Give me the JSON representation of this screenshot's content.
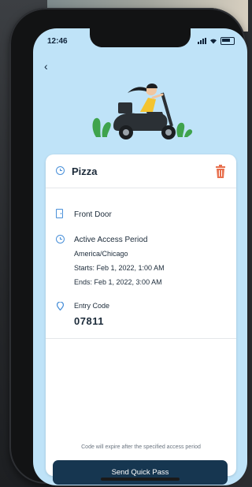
{
  "status_bar": {
    "time": "12:46"
  },
  "colors": {
    "screen_background": "#bfe3f8",
    "primary_button": "#163650",
    "icon_accent": "#4a90d9",
    "delete_icon": "#e8704e",
    "plant_green": "#3fa34d"
  },
  "pass": {
    "title": "Pizza",
    "lock_name": "Front Door",
    "access": {
      "heading": "Active Access Period",
      "timezone": "America/Chicago",
      "starts": "Starts: Feb 1, 2022, 1:00 AM",
      "ends": "Ends: Feb 1, 2022, 3:00 AM"
    },
    "entry_code_label": "Entry Code",
    "entry_code": "07811"
  },
  "footer": {
    "note": "Code will expire after the specified access period",
    "send_button": "Send Quick Pass"
  }
}
